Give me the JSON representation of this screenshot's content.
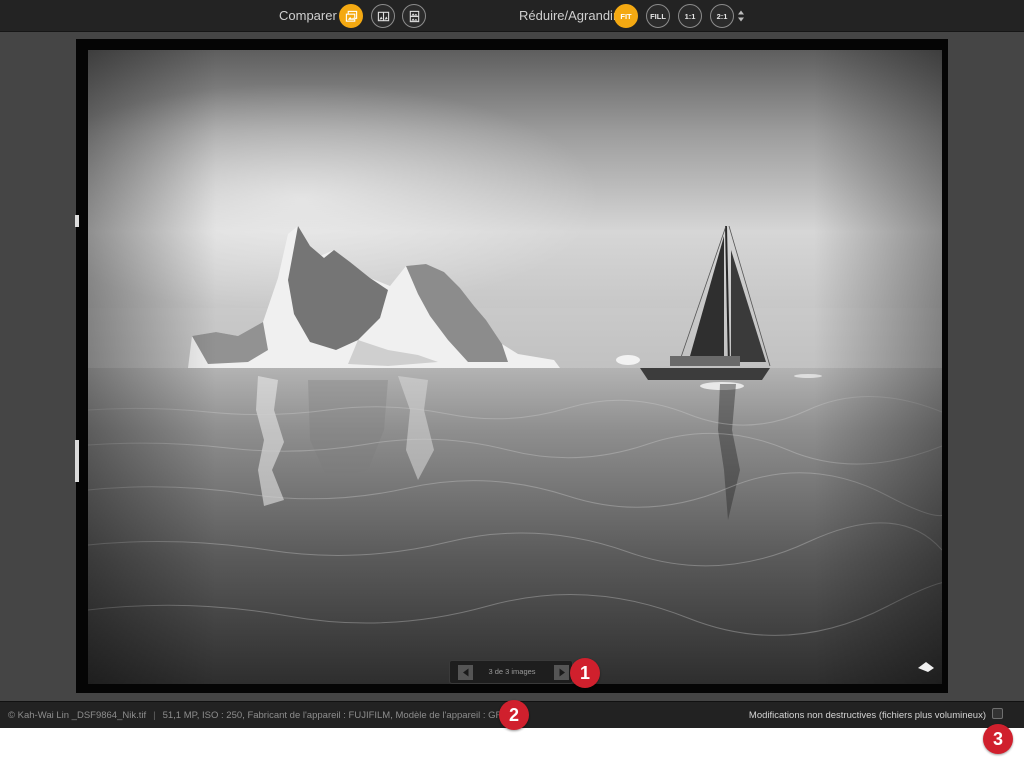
{
  "toolbar": {
    "compare_label": "Comparer",
    "zoom_label": "Réduire/Agrandir",
    "compare_buttons": [
      {
        "icon": "compare-single-icon",
        "active": true
      },
      {
        "icon": "compare-side-by-side-icon",
        "active": false
      },
      {
        "icon": "compare-split-icon",
        "active": false
      }
    ],
    "zoom_buttons": [
      {
        "label": "FIT",
        "active": true
      },
      {
        "label": "FILL",
        "active": false
      },
      {
        "label": "1:1",
        "active": false
      },
      {
        "label": "2:1",
        "active": false
      }
    ],
    "accent_color": "#f4a912"
  },
  "pager": {
    "text": "3 de 3 images",
    "prev_icon": "triangle-left-icon",
    "next_icon": "triangle-right-icon"
  },
  "status": {
    "file": "© Kah-Wai Lin _DSF9864_Nik.tif",
    "separator": "|",
    "info": "51,1 MP, ISO : 250, Fabricant de l'appareil : FUJIFILM, Modèle de l'appareil : GFX 50R",
    "nondestructive_label": "Modifications non destructives (fichiers plus volumineux)",
    "nondestructive_checked": false
  },
  "callouts": [
    "1",
    "2",
    "3"
  ],
  "callout_color": "#d0202d"
}
